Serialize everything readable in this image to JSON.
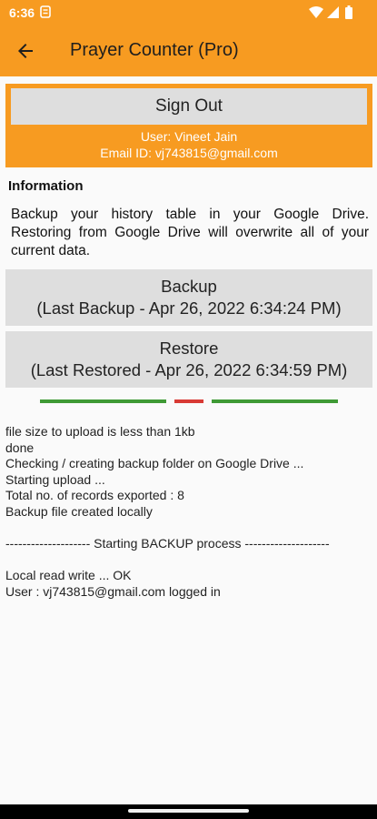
{
  "status_bar": {
    "time": "6:36",
    "icons": [
      "sync-icon",
      "wifi-icon",
      "signal-icon",
      "battery-icon"
    ]
  },
  "app_bar": {
    "title": "Prayer Counter (Pro)",
    "back_icon": "arrow-left-icon"
  },
  "account": {
    "sign_out_label": "Sign Out",
    "user_line": "User: Vineet Jain",
    "email_line": "Email ID: vj743815@gmail.com"
  },
  "info": {
    "heading": "Information",
    "text": "Backup your history table in your Google Drive. Restoring from Google Drive will overwrite all of your current data."
  },
  "backup": {
    "label": "Backup",
    "detail": "(Last Backup - Apr 26, 2022 6:34:24 PM)"
  },
  "restore": {
    "label": "Restore",
    "detail": "(Last Restored - Apr 26, 2022 6:34:59 PM)"
  },
  "log": [
    "file size to upload is less than 1kb",
    "done",
    "Checking / creating backup folder on Google Drive ...",
    "Starting upload ...",
    "Total no. of records exported : 8",
    "Backup file created locally",
    "",
    "-------------------- Starting BACKUP process --------------------",
    "",
    "Local read write ... OK",
    "User : vj743815@gmail.com logged in"
  ],
  "colors": {
    "accent": "#f79b21",
    "button": "#dedede",
    "progress_ok": "#3f9a35",
    "progress_err": "#d83a34"
  }
}
